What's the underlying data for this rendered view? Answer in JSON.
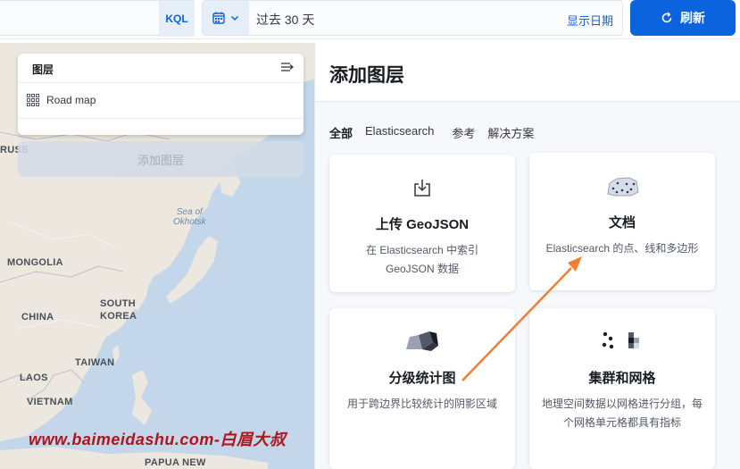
{
  "topbar": {
    "query_lang": "KQL",
    "date_range": "过去 30 天",
    "show_dates": "显示日期",
    "refresh_label": "刷新"
  },
  "map": {
    "labels": {
      "russia": "RUSS",
      "mongolia": "MONGOLIA",
      "china": "CHINA",
      "south_korea_1": "SOUTH",
      "south_korea_2": "KOREA",
      "taiwan": "TAIWAN",
      "laos": "LAOS",
      "vietnam": "VIETNAM",
      "papua": "PAPUA NEW",
      "sea_1": "Sea of",
      "sea_2": "Okhotsk"
    },
    "layers_panel": {
      "title": "图层",
      "items": [
        {
          "label": "Road map"
        }
      ]
    },
    "add_layer_button": "添加图层"
  },
  "panel": {
    "title": "添加图层",
    "tabs": [
      "全部",
      "Elasticsearch",
      "参考",
      "解决方案"
    ],
    "cards": [
      {
        "title": "上传 GeoJSON",
        "desc": "在 Elasticsearch 中索引 GeoJSON 数据"
      },
      {
        "title": "文档",
        "desc": "Elasticsearch 的点、线和多边形"
      },
      {
        "title": "分级统计图",
        "desc": "用于跨边界比较统计的阴影区域"
      },
      {
        "title": "集群和网格",
        "desc": "地理空间数据以网格进行分组，每个网格单元格都具有指标"
      }
    ]
  },
  "watermark": "www.baimeidashu.com-白眉大叔"
}
